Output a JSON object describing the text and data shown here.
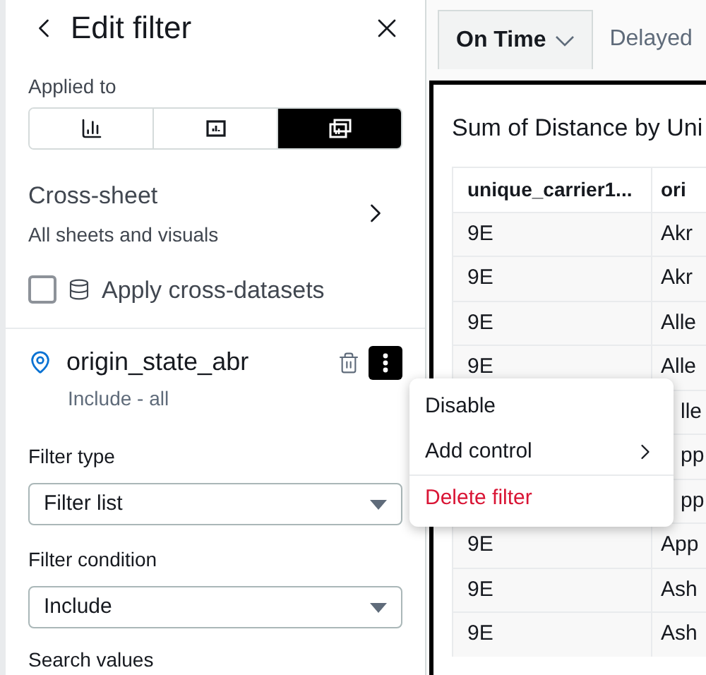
{
  "panel": {
    "title": "Edit filter",
    "applied_to": {
      "label": "Applied to",
      "options": [
        {
          "kind": "visual",
          "selected": false
        },
        {
          "kind": "sheet",
          "selected": false
        },
        {
          "kind": "cross",
          "selected": true
        }
      ]
    },
    "scope": {
      "title": "Cross-sheet",
      "subtitle": "All sheets and visuals"
    },
    "cross_datasets": {
      "label": "Apply cross-datasets",
      "checked": false
    },
    "filter": {
      "name": "origin_state_abr",
      "summary": "Include - all"
    },
    "fields": [
      {
        "label": "Filter type",
        "value": "Filter list"
      },
      {
        "label": "Filter condition",
        "value": "Include"
      }
    ],
    "next_label": "Search values"
  },
  "menu": {
    "items": [
      {
        "label": "Disable",
        "kind": "plain"
      },
      {
        "label": "Add control",
        "kind": "submenu"
      },
      {
        "label": "Delete filter",
        "kind": "danger"
      }
    ]
  },
  "sheet_tabs": [
    {
      "label": "On Time",
      "selected": true
    },
    {
      "label": "Delayed",
      "selected": false
    }
  ],
  "visual": {
    "title": "Sum of Distance by Uni",
    "columns": [
      "unique_carrier1...",
      "ori"
    ],
    "rows": [
      {
        "covered": false,
        "cells": [
          "9E",
          "Akr"
        ]
      },
      {
        "covered": false,
        "cells": [
          "9E",
          "Akr"
        ]
      },
      {
        "covered": false,
        "cells": [
          "9E",
          "Alle"
        ]
      },
      {
        "covered": false,
        "cells": [
          "9E",
          "Alle"
        ]
      },
      {
        "covered": true,
        "cells": [
          "lle"
        ]
      },
      {
        "covered": true,
        "cells": [
          "pp"
        ]
      },
      {
        "covered": true,
        "cells": [
          "pp"
        ]
      },
      {
        "covered": false,
        "cells": [
          "9E",
          "App"
        ]
      },
      {
        "covered": false,
        "cells": [
          "9E",
          "Ash"
        ]
      },
      {
        "covered": false,
        "cells": [
          "9E",
          "Ash"
        ]
      }
    ]
  }
}
